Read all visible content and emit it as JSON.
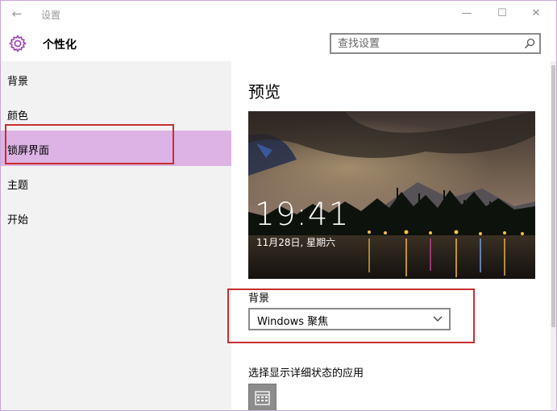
{
  "window": {
    "title": "设置",
    "back_glyph": "←",
    "minimize_glyph": "—",
    "maximize_glyph": "☐",
    "close_glyph": "✕"
  },
  "header": {
    "icon": "gear-icon",
    "title": "个性化",
    "search_placeholder": "查找设置",
    "search_value": ""
  },
  "sidebar": {
    "items": [
      {
        "label": "背景",
        "selected": false
      },
      {
        "label": "颜色",
        "selected": false
      },
      {
        "label": "锁屏界面",
        "selected": true
      },
      {
        "label": "主题",
        "selected": false
      },
      {
        "label": "开始",
        "selected": false
      }
    ]
  },
  "content": {
    "preview_title": "预览",
    "lock_time": "19:41",
    "lock_date": "11月28日, 星期六",
    "background_label": "背景",
    "background_value": "Windows 聚焦",
    "apps_label": "选择显示详细状态的应用",
    "app_icon": "calendar-icon"
  },
  "colors": {
    "accent": "#dcb3e4",
    "sidebar_bg": "#f2f2f2",
    "annotation_red": "#c62f2f",
    "window_border": "#c9a6d6"
  }
}
